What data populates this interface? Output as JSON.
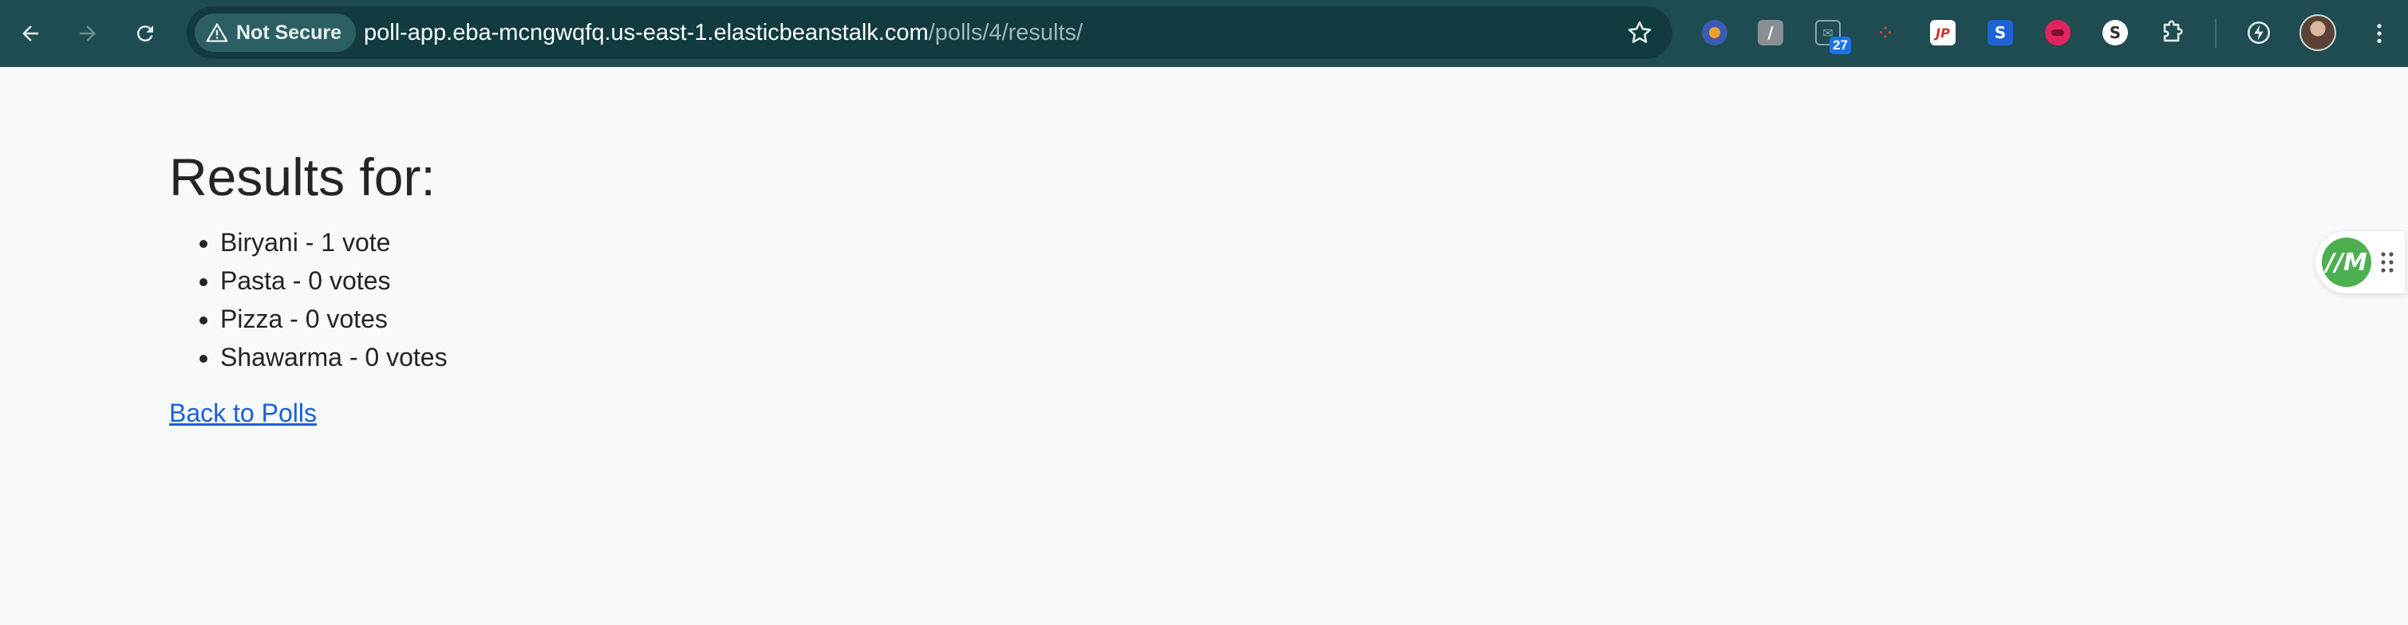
{
  "browser": {
    "security_label": "Not Secure",
    "url_host": "poll-app.eba-mcngwqfq.us-east-1.elasticbeanstalk.com",
    "url_path": "/polls/4/results/",
    "extension_badge": "27",
    "icons": {
      "back": "arrow-left",
      "forward": "arrow-right",
      "reload": "reload",
      "warning": "warning-triangle",
      "bookmark": "star",
      "extensions": "puzzle",
      "menu": "three-dots-vertical"
    },
    "colors": {
      "toolbar": "#1e4c50",
      "omnibox": "#123b3f"
    }
  },
  "page": {
    "heading": "Results for:",
    "results": [
      {
        "text": "Biryani - 1 vote"
      },
      {
        "text": "Pasta - 0 votes"
      },
      {
        "text": "Pizza - 0 votes"
      },
      {
        "text": "Shawarma - 0 votes"
      }
    ],
    "back_link": "Back to Polls"
  },
  "widget": {
    "logo_text": "//M",
    "color": "#4caf50"
  }
}
